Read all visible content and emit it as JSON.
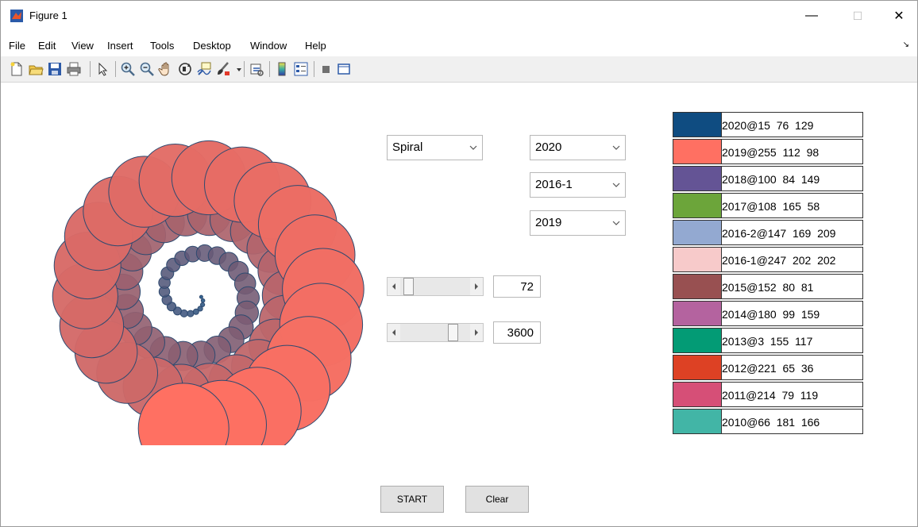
{
  "window": {
    "title": "Figure 1",
    "minimize": "—",
    "maximize": "☐",
    "close": "✕"
  },
  "menu": [
    "File",
    "Edit",
    "View",
    "Insert",
    "Tools",
    "Desktop",
    "Window",
    "Help"
  ],
  "toolbar_icons": [
    "new-figure-icon",
    "open-file-icon",
    "save-icon",
    "print-icon",
    "pointer-icon",
    "zoom-in-icon",
    "zoom-out-icon",
    "pan-icon",
    "rotate-3d-icon",
    "data-cursor-icon",
    "brush-icon",
    "brush-dropdown-icon",
    "link-plot-icon",
    "colorbar-icon",
    "legend-icon",
    "hide-plot-tools-icon",
    "show-plot-tools-icon"
  ],
  "controls": {
    "style_select": "Spiral",
    "year_select_1": "2020",
    "year_select_2": "2016-1",
    "year_select_3": "2019",
    "slider1_value": "72",
    "slider2_value": "3600",
    "slider1_fraction": 0.05,
    "slider2_fraction": 0.8,
    "start_label": "START",
    "clear_label": "Clear"
  },
  "legend": [
    {
      "label": "2020@15  76  129",
      "color": "#0f4c81"
    },
    {
      "label": "2019@255  112  98",
      "color": "#ff7062"
    },
    {
      "label": "2018@100  84  149",
      "color": "#645495"
    },
    {
      "label": "2017@108  165  58",
      "color": "#6ca53a"
    },
    {
      "label": "2016-2@147  169  209",
      "color": "#93a9d1"
    },
    {
      "label": "2016-1@247  202  202",
      "color": "#f7caca"
    },
    {
      "label": "2015@152  80  81",
      "color": "#985051"
    },
    {
      "label": "2014@180  99  159",
      "color": "#b4639f"
    },
    {
      "label": "2013@3  155  117",
      "color": "#039b75"
    },
    {
      "label": "2012@221  65  36",
      "color": "#dd4124"
    },
    {
      "label": "2011@214  79  119",
      "color": "#d64f77"
    },
    {
      "label": "2010@66  181  166",
      "color": "#42b5a6"
    }
  ],
  "spiral": {
    "color_start": "#0f4c81",
    "color_end": "#ff7062",
    "outline": "#2e4a70"
  }
}
